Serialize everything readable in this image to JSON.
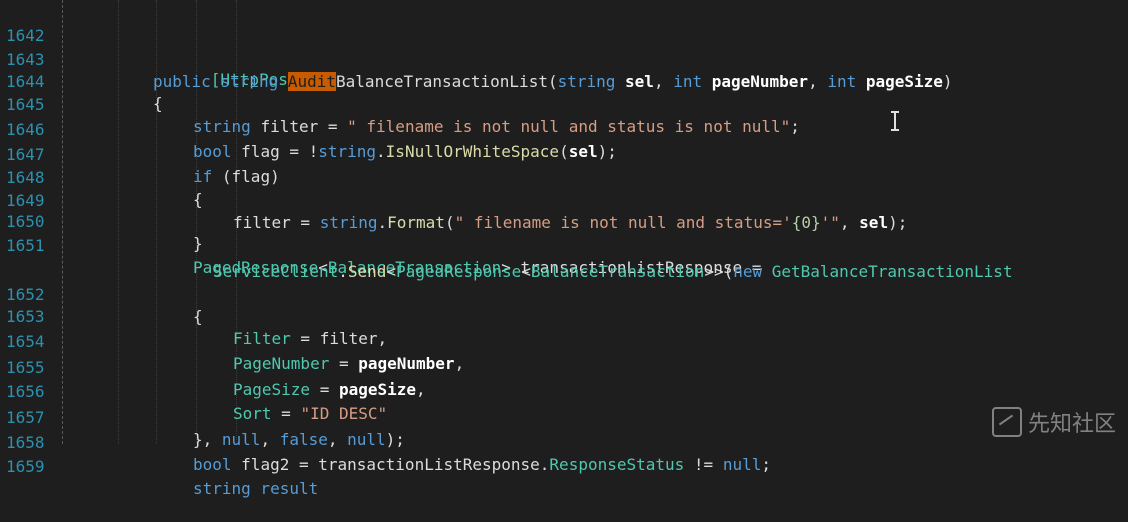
{
  "lines": [
    {
      "num": "1642"
    },
    {
      "num": "1643"
    },
    {
      "num": "1644"
    },
    {
      "num": "1645"
    },
    {
      "num": "1646"
    },
    {
      "num": "1647"
    },
    {
      "num": "1648"
    },
    {
      "num": "1649"
    },
    {
      "num": "1650"
    },
    {
      "num": "1651"
    },
    {
      "num": "1652"
    },
    {
      "num": "1653"
    },
    {
      "num": "1654"
    },
    {
      "num": "1655"
    },
    {
      "num": "1656"
    },
    {
      "num": "1657"
    },
    {
      "num": "1658"
    },
    {
      "num": "1659"
    }
  ],
  "code": {
    "l1642": "[HttpPost]",
    "l1643_a": "public string ",
    "l1643_hl": "Audit",
    "l1643_b": "BalanceTransactionList(",
    "l1643_c": "string ",
    "l1643_d": "sel",
    "l1643_e": ", ",
    "l1643_f": "int ",
    "l1643_g": "pageNumber",
    "l1643_h": ", ",
    "l1643_i": "int ",
    "l1643_j": "pageSize",
    "l1643_k": ")",
    "l1644": "{",
    "l1645_a": "string ",
    "l1645_b": "filter = ",
    "l1645_c": "\" filename is not null and status is not null\"",
    "l1645_d": ";",
    "l1646_a": "bool ",
    "l1646_b": "flag = !",
    "l1646_c": "string",
    "l1646_d": ".",
    "l1646_e": "IsNullOrWhiteSpace",
    "l1646_f": "(",
    "l1646_g": "sel",
    "l1646_h": ");",
    "l1647_a": "if ",
    "l1647_b": "(flag)",
    "l1648": "{",
    "l1649_a": "filter = ",
    "l1649_b": "string",
    "l1649_c": ".",
    "l1649_d": "Format",
    "l1649_e": "(",
    "l1649_f": "\" filename is not null and status='",
    "l1649_g": "{0}",
    "l1649_h": "'\"",
    "l1649_i": ", ",
    "l1649_j": "sel",
    "l1649_k": ");",
    "l1650": "}",
    "l1651_a": "PagedResponse",
    "l1651_b": "<",
    "l1651_c": "BalanceTransaction",
    "l1651_d": "> transactionListResponse =",
    "l1651w_a": "ServiceClient",
    "l1651w_b": ".",
    "l1651w_c": "Send",
    "l1651w_d": "<",
    "l1651w_e": "PagedResponse",
    "l1651w_f": "<",
    "l1651w_g": "BalanceTransaction",
    "l1651w_h": ">>(",
    "l1651w_i": "new ",
    "l1651w_j": "GetBalanceTransactionList",
    "l1652": "{",
    "l1653_a": "Filter",
    "l1653_b": " = filter,",
    "l1654_a": "PageNumber",
    "l1654_b": " = ",
    "l1654_c": "pageNumber",
    "l1654_d": ",",
    "l1655_a": "PageSize",
    "l1655_b": " = ",
    "l1655_c": "pageSize",
    "l1655_d": ",",
    "l1656_a": "Sort",
    "l1656_b": " = ",
    "l1656_c": "\"ID DESC\"",
    "l1657_a": "}, ",
    "l1657_b": "null",
    "l1657_c": ", ",
    "l1657_d": "false",
    "l1657_e": ", ",
    "l1657_f": "null",
    "l1657_g": ");",
    "l1658_a": "bool ",
    "l1658_b": "flag2 = transactionListResponse.",
    "l1658_c": "ResponseStatus",
    "l1658_d": " != ",
    "l1658_e": "null",
    "l1658_f": ";",
    "l1659_a": "string result"
  },
  "watermark": {
    "text": "先知社区",
    "icon": "xianzhi-logo-icon"
  },
  "cursor": {
    "icon": "text-cursor-icon"
  },
  "colors": {
    "background": "#1e1e1e",
    "line_number": "#2b91af",
    "keyword": "#569cd6",
    "type": "#4ec9b0",
    "string": "#d69d85",
    "method": "#dcdcaa",
    "highlight": "#c85b00"
  }
}
